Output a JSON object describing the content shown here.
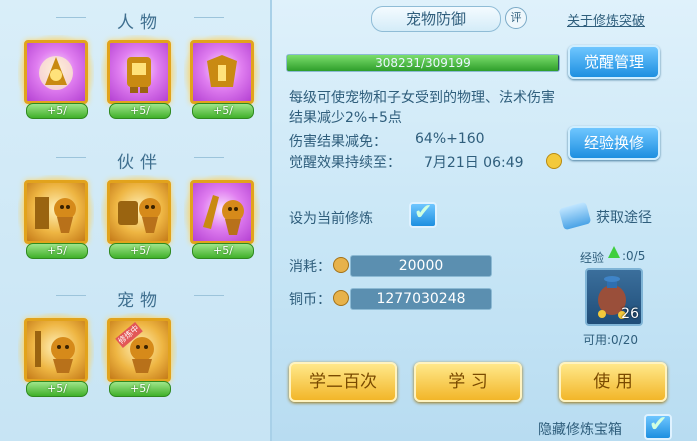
{
  "sections": {
    "character": {
      "title": "人物",
      "slots": [
        {
          "plus": "+5/"
        },
        {
          "plus": "+5/"
        },
        {
          "plus": "+5/"
        }
      ]
    },
    "partner": {
      "title": "伙伴",
      "slots": [
        {
          "plus": "+5/"
        },
        {
          "plus": "+5/"
        },
        {
          "plus": "+5/"
        }
      ]
    },
    "pet": {
      "title": "宠物",
      "slots": [
        {
          "plus": "+5/"
        },
        {
          "plus": "+5/",
          "banner": "修炼中"
        }
      ]
    }
  },
  "header": {
    "title": "宠物防御",
    "rate_label": "评",
    "link": "关于修炼突破"
  },
  "exp": {
    "text": "308231/309199",
    "fraction": 0.997
  },
  "buttons": {
    "awaken": "觉醒管理",
    "exchange": "经验换修",
    "learn_200": "学二百次",
    "learn": "学 习",
    "use": "使 用"
  },
  "description": "每级可使宠物和子女受到的物理、法术伤害结果减少2%+5点",
  "damage": {
    "label": "伤害结果减免：",
    "value": "64%+160"
  },
  "awaken_duration": {
    "label": "觉醒效果持续至：",
    "value": "7月21日 06:49"
  },
  "set_current": {
    "label": "设为当前修炼",
    "checked": true
  },
  "acquire": {
    "label": "获取途径"
  },
  "cost": {
    "label": "消耗：",
    "value": "20000"
  },
  "coins": {
    "label": "铜币：",
    "value": "1277030248"
  },
  "item": {
    "exp_label": "经验",
    "exp_count": ":0/5",
    "count": "26",
    "usable": "可用:0/20"
  },
  "hide": {
    "label": "隐藏修炼宝箱",
    "checked": true
  },
  "colors": {
    "accent": "#1d8fe0",
    "gold": "#f2b629",
    "text": "#2f5e7c",
    "highlight": "#e0a000"
  }
}
